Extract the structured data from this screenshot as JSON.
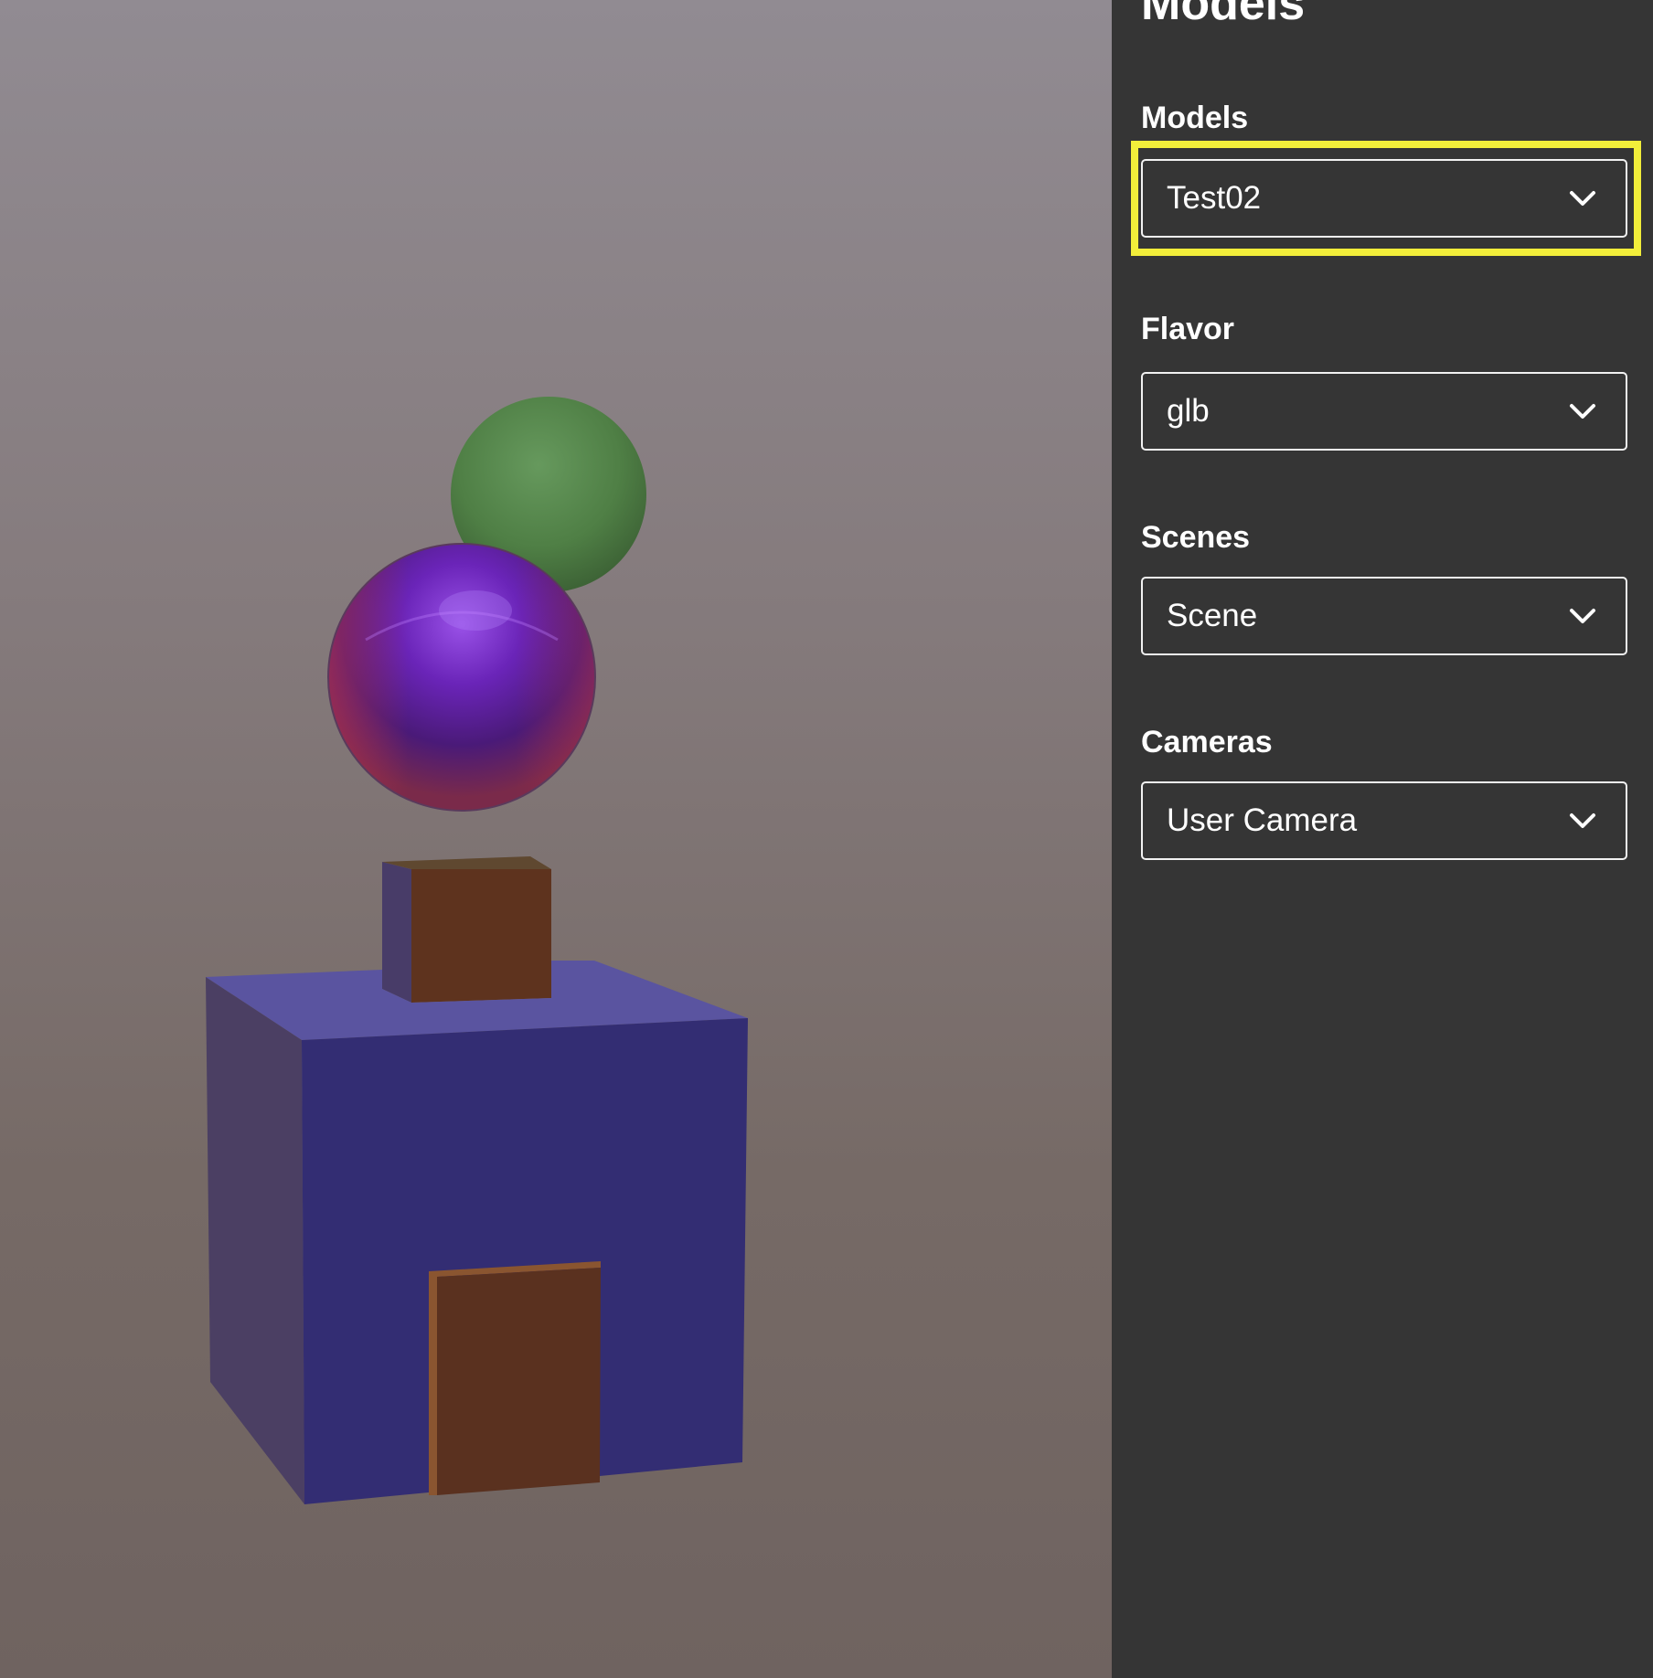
{
  "panel": {
    "title": "Models",
    "fields": {
      "models": {
        "label": "Models",
        "value": "Test02"
      },
      "flavor": {
        "label": "Flavor",
        "value": "glb"
      },
      "scenes": {
        "label": "Scenes",
        "value": "Scene"
      },
      "cameras": {
        "label": "Cameras",
        "value": "User Camera"
      }
    }
  },
  "icons": {
    "dropdown": "chevron-down-icon"
  },
  "colors": {
    "panel_background": "#353535",
    "highlight": "#f2ee3a",
    "viewport_background": "#857b7d"
  }
}
